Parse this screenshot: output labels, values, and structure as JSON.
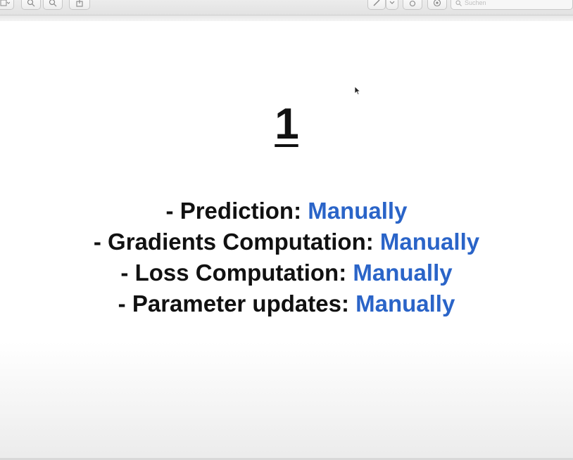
{
  "toolbar": {
    "buttons": [
      {
        "name": "sidebar-view-button",
        "icon": "sidebar-icon"
      },
      {
        "name": "zoom-out-button",
        "icon": "zoom-out-icon"
      },
      {
        "name": "zoom-in-button",
        "icon": "zoom-in-icon"
      },
      {
        "name": "share-button",
        "icon": "share-icon"
      },
      {
        "name": "markup-button",
        "icon": "pencil-icon"
      },
      {
        "name": "markup-menu-button",
        "icon": "chevron-down-icon"
      },
      {
        "name": "rotate-button",
        "icon": "rotate-icon"
      },
      {
        "name": "annotate-button",
        "icon": "annotate-icon"
      }
    ],
    "search": {
      "placeholder": "Suchen",
      "icon": "search-icon"
    }
  },
  "slide": {
    "number": "1",
    "bullets": [
      {
        "label": "- Prediction:",
        "value": "Manually"
      },
      {
        "label": "- Gradients Computation:",
        "value": "Manually"
      },
      {
        "label": "- Loss Computation:",
        "value": "Manually"
      },
      {
        "label": "- Parameter updates:",
        "value": "Manually"
      }
    ]
  },
  "colors": {
    "accent": "#2a64c8",
    "text": "#111111",
    "toolbar": "#e6e6e6"
  }
}
